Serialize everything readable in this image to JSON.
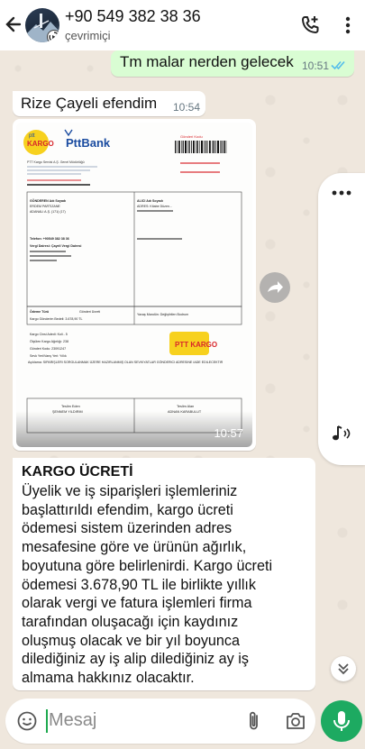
{
  "header": {
    "contact_name": "+90 549 382 38 36",
    "status": "çevrimiçi",
    "icons": [
      "back-arrow-icon",
      "add-call-icon",
      "more-vert-icon"
    ]
  },
  "messages": [
    {
      "direction": "out",
      "text": "Tm malar nerden gelecek",
      "time": "10:51",
      "read": true
    },
    {
      "direction": "in",
      "text": "Rize Çayeli efendim",
      "time": "10:54"
    },
    {
      "direction": "in",
      "type": "image",
      "time": "10:57",
      "image": {
        "bank_name": "PttBank",
        "brand_text": "PTT KARGO",
        "header_small": "PTT Kargo Servisi A.Ş. Genel Müdürlüğü",
        "gonderi_kodu_label": "Gönderi Kodu",
        "sender_label": "GÖNDEREN Adı Soyadı",
        "sender_name": "ERDEM PARTIZANE",
        "receiver_label": "ALICI Adı Soyadı",
        "phone_line": "Telefon: +90549 382 38 36",
        "vergi_line": "Vergi Dairesi: Çayeli Vergi Dairesi",
        "sender_address": "ADANALI A.Ş. (171) (17)",
        "receiver_address": "ADRES: Kitabe Düzen...",
        "odeme_label": "Ödeme Türü",
        "odeme_value": "Gönderi Ücreti",
        "odeme_note": "Yavaş Mandün: Değiştirilen Bodrum",
        "amount_line": "Kargo Gönderim Bedeli: 3.678,90 TL",
        "kargo_cinsi": "Kargo Cinsi Adedi: Koli - 5",
        "kargo_agirlik": "Ölçülen Kargo Ağırlığı: 238",
        "gonderi_kodu": "Gönderi Kodu: 23091247",
        "sevk_line": "Sevk Yeri/Varış Yeri: Yıllık",
        "aciklama": "Açıklama: SİPARİŞLERİ SORGULANMAK ÜZERE HAZIRLANMIŞ OLAN SEVKİYATLAR GÖNDERİCİ ADRESİNE İADE EDİLECEKTİR",
        "teslim_eden_label": "Teslim Eden",
        "teslim_eden_name": "ŞENNEM YILDIRIM",
        "teslim_alan_label": "Teslim Alan",
        "teslim_alan_name": "ADNAN KARABULUT"
      }
    },
    {
      "direction": "in",
      "heading": "KARGO ÜCRETİ",
      "lines": [
        "Üyelik ve iş siparişleri işlemleriniz",
        "başlattırıldı efendim, kargo ücreti",
        "ödemesi sistem üzerinden adres",
        "mesafesine göre ve ürünün ağırlık,",
        "boyutuna göre belirlenirdi. Kargo ücreti",
        "ödemesi 3.678,90 TL ile birlikte yıllık",
        "olarak vergi ve fatura işlemleri firma",
        "tarafından oluşacağı için kaydınız",
        "oluşmuş olacak ve bir yıl boyunca",
        "dilediğiniz ay iş alip dilediğiniz ay iş",
        "almama hakkınız olacaktır."
      ]
    }
  ],
  "input": {
    "placeholder": "Mesaj",
    "icons": [
      "emoji-icon",
      "attach-icon",
      "camera-icon",
      "mic-icon"
    ]
  },
  "colors": {
    "outgoing_bubble": "#d9fdd3",
    "incoming_bubble": "#ffffff",
    "chat_background": "#efe7dd",
    "accent_green": "#1daa61",
    "read_tick_blue": "#53bdeb"
  }
}
